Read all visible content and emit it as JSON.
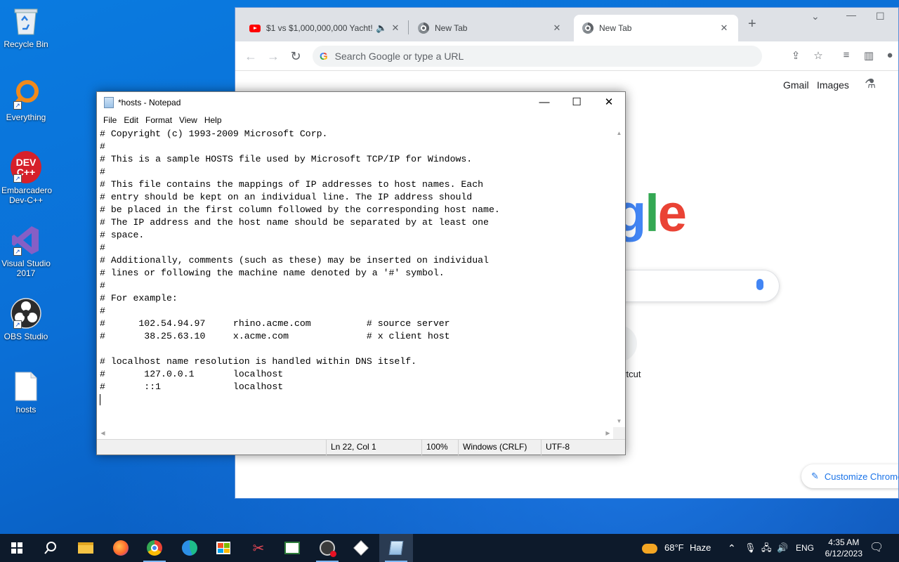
{
  "desktop": {
    "icons": [
      {
        "label": "Recycle Bin",
        "icon": "recycle-bin-icon"
      },
      {
        "label": "Everything",
        "icon": "everything-search-icon"
      },
      {
        "label": "Embarcadero Dev-C++",
        "icon": "devcpp-icon",
        "glyph_text": "DEV C++"
      },
      {
        "label": "Visual Studio 2017",
        "icon": "visual-studio-icon"
      },
      {
        "label": "OBS Studio",
        "icon": "obs-studio-icon"
      },
      {
        "label": "hosts",
        "icon": "file-icon"
      }
    ]
  },
  "chrome": {
    "tabs": [
      {
        "title": "$1 vs $1,000,000,000 Yacht!",
        "icon": "youtube-icon",
        "audio": true
      },
      {
        "title": "New Tab",
        "icon": "chrome-icon"
      },
      {
        "title": "New Tab",
        "icon": "chrome-icon",
        "active": true
      }
    ],
    "omnibox_placeholder": "Search Google or type a URL",
    "top_links": {
      "gmail": "Gmail",
      "images": "Images"
    },
    "logo_visible_text": "gle",
    "shortcut_label": "ortcut",
    "customize_label": "Customize Chrome"
  },
  "notepad": {
    "title": "*hosts - Notepad",
    "menu": [
      "File",
      "Edit",
      "Format",
      "View",
      "Help"
    ],
    "lines": [
      "# Copyright (c) 1993-2009 Microsoft Corp.",
      "#",
      "# This is a sample HOSTS file used by Microsoft TCP/IP for Windows.",
      "#",
      "# This file contains the mappings of IP addresses to host names. Each",
      "# entry should be kept on an individual line. The IP address should",
      "# be placed in the first column followed by the corresponding host name.",
      "# The IP address and the host name should be separated by at least one",
      "# space.",
      "#",
      "# Additionally, comments (such as these) may be inserted on individual",
      "# lines or following the machine name denoted by a '#' symbol.",
      "#",
      "# For example:",
      "#",
      "#      102.54.94.97     rhino.acme.com          # source server",
      "#       38.25.63.10     x.acme.com              # x client host",
      "",
      "# localhost name resolution is handled within DNS itself.",
      "#\t127.0.0.1       localhost",
      "#\t::1             localhost",
      ""
    ],
    "status": {
      "position": "Ln 22, Col 1",
      "zoom": "100%",
      "line_ending": "Windows (CRLF)",
      "encoding": "UTF-8"
    }
  },
  "taskbar": {
    "apps": [
      "start-icon",
      "search-icon",
      "file-explorer-icon",
      "firefox-icon",
      "chrome-icon",
      "edge-icon",
      "store-icon",
      "snipping-tool-icon",
      "app-icon",
      "obs-icon",
      "cube-app-icon",
      "notepad-icon"
    ],
    "weather": {
      "temp": "68°F",
      "condition": "Haze"
    },
    "language": "ENG",
    "time": "4:35 AM",
    "date": "6/12/2023"
  }
}
